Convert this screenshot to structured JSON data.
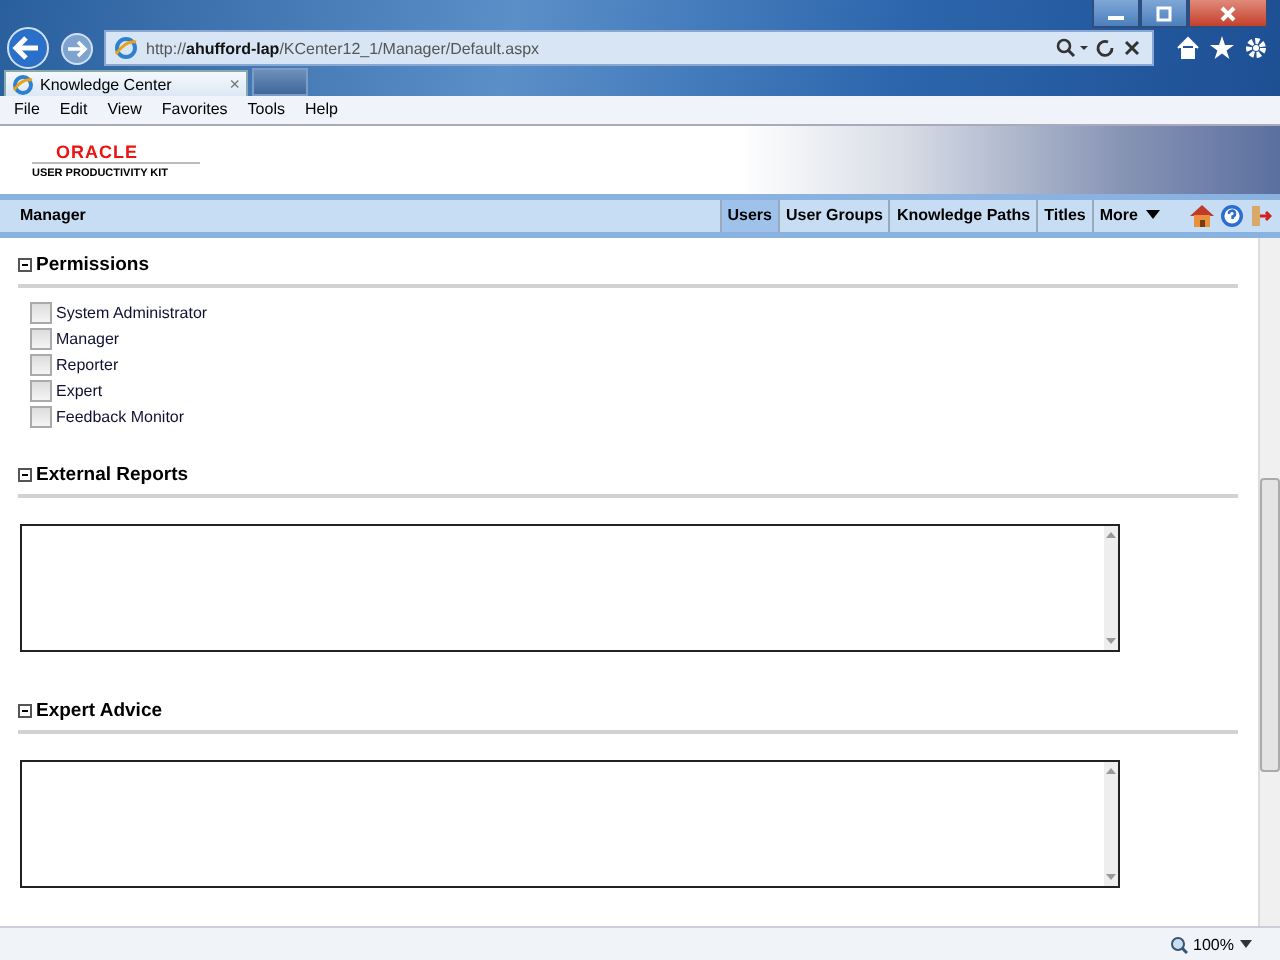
{
  "browser": {
    "url": "http://**ahufford-lap**/KCenter12_1/Manager/Default.aspx",
    "tab": {
      "title": "Knowledge Center",
      "close": "×"
    },
    "menu": [
      "File",
      "Edit",
      "View",
      "Favorites",
      "Tools",
      "Help"
    ]
  },
  "header": {
    "logo": "ORACLE",
    "product": "USER PRODUCTIVITY KIT"
  },
  "nav": {
    "title": "Manager",
    "tabs": [
      {
        "label": "Users",
        "selected": true
      },
      {
        "label": "User Groups",
        "selected": false
      },
      {
        "label": "Knowledge Paths",
        "selected": false
      },
      {
        "label": "Titles",
        "selected": false
      },
      {
        "label": "More",
        "selected": false,
        "dropdown": true
      }
    ]
  },
  "sections": [
    {
      "title": "Permissions",
      "expanded": true,
      "kind": "checklist",
      "items": [
        {
          "label": "System Administrator",
          "checked": false
        },
        {
          "label": "Manager",
          "checked": false
        },
        {
          "label": "Reporter",
          "checked": false
        },
        {
          "label": "Expert",
          "checked": false
        },
        {
          "label": "Feedback Monitor",
          "checked": false
        }
      ]
    },
    {
      "title": "External Reports",
      "expanded": true,
      "kind": "textarea"
    },
    {
      "title": "Expert Advice",
      "expanded": true,
      "kind": "textarea"
    }
  ],
  "status_bar": {
    "zoom": "100%"
  }
}
